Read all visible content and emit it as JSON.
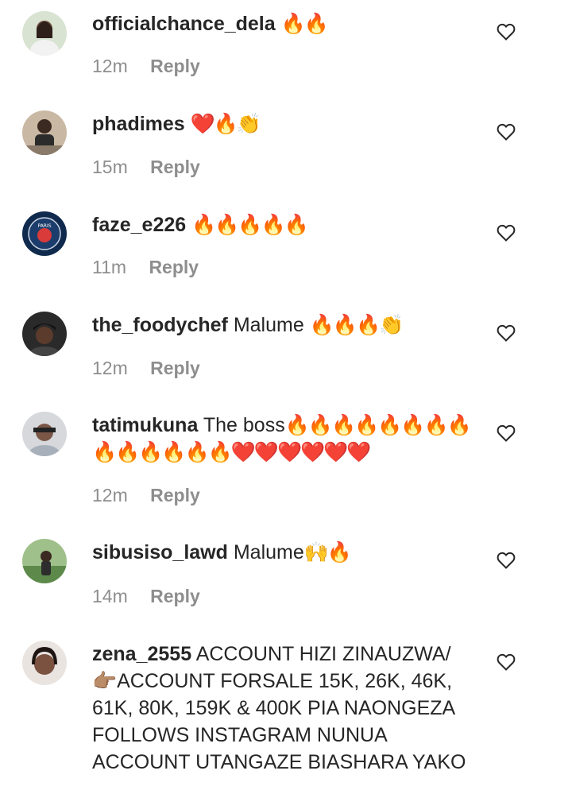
{
  "reply_label": "Reply",
  "comments": [
    {
      "username": "officialchance_dela",
      "text": "",
      "emoji": "🔥🔥",
      "time": "12m"
    },
    {
      "username": "phadimes",
      "text": "",
      "emoji": "❤️🔥👏",
      "time": "15m"
    },
    {
      "username": "faze_e226",
      "text": "",
      "emoji": "🔥🔥🔥🔥🔥",
      "time": "11m"
    },
    {
      "username": "the_foodychef",
      "text": "Malume",
      "emoji": "🔥🔥🔥👏",
      "time": "12m"
    },
    {
      "username": "tatimukuna",
      "text": "The boss",
      "emoji": "🔥🔥🔥🔥🔥🔥🔥🔥🔥🔥🔥🔥🔥🔥❤️❤️❤️❤️❤️❤️",
      "time": "12m"
    },
    {
      "username": "sibusiso_lawd",
      "text": "Malume",
      "emoji": "🙌🔥",
      "time": "14m"
    },
    {
      "username": "zena_2555",
      "text": "ACCOUNT HIZI ZINAUZWA/ 👉🏽ACCOUNT FORSALE 15K, 26K, 46K, 61K, 80K, 159K & 400K PIA NAONGEZA FOLLOWS INSTAGRAM NUNUA ACCOUNT UTANGAZE BIASHARA YAKO",
      "emoji": "",
      "time": ""
    }
  ],
  "colors": {
    "text": "#262626",
    "muted": "#8e8e8e",
    "fire": "#f05a1a",
    "heart": "#e3243b"
  },
  "avatar_badge_text": "PARIS"
}
